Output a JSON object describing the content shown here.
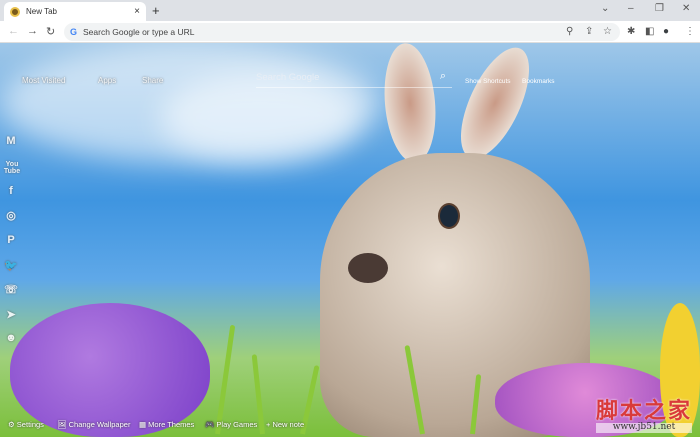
{
  "tab": {
    "title": "New Tab",
    "close": "×",
    "new_tab": "+"
  },
  "window": {
    "tab_search": "⌄",
    "minimize": "–",
    "restore": "❐",
    "close": "✕"
  },
  "toolbar": {
    "back": "←",
    "forward": "→",
    "reload": "↻",
    "google_g": "G",
    "omnibox_placeholder": "Search Google or type a URL",
    "zoom": "⚲",
    "share": "⇪",
    "star": "☆",
    "extensions": "✱",
    "sidepanel": "◧",
    "profile": "●",
    "menu": "⋮"
  },
  "page": {
    "top_nav": [
      "Most Visited",
      "Apps",
      "Share"
    ],
    "search_placeholder": "Search Google",
    "search_icon": "⌕",
    "links": [
      "Show Shortcuts",
      "Bookmarks"
    ],
    "social": [
      "M",
      "You Tube",
      "f",
      "◎",
      "P",
      "🐦",
      "☏",
      "➤",
      "☻"
    ],
    "bottom": [
      "⚙ Settings",
      "🖼 Change Wallpaper",
      "▦ More Themes",
      "🎮 Play Games",
      "+ New note"
    ]
  },
  "watermark": {
    "cn": "脚本之家",
    "url": "www.jb51.net"
  }
}
